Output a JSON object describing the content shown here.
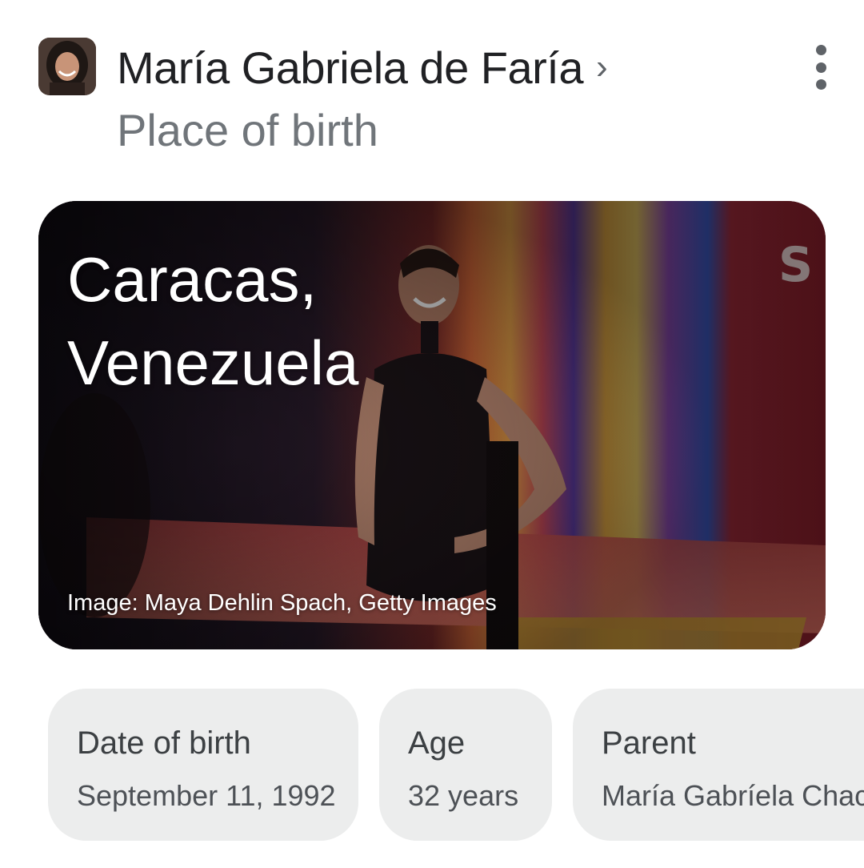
{
  "header": {
    "entity_name": "María Gabriela de Faría",
    "chevron": "›",
    "subtitle": "Place of birth",
    "avatar_icon": "person-photo",
    "more_icon": "more-vert-icon"
  },
  "hero": {
    "title_line1": "Caracas,",
    "title_line2": "Venezuela",
    "credit": "Image: Maya Dehlin Spach, Getty Images"
  },
  "facts": [
    {
      "label": "Date of birth",
      "value": "September 11, 1992"
    },
    {
      "label": "Age",
      "value": "32 years"
    },
    {
      "label": "Parent",
      "value": "María Gabríela Chacón"
    }
  ],
  "colors": {
    "title": "#202124",
    "subtitle": "#70757a",
    "chip_bg": "#eceded"
  }
}
